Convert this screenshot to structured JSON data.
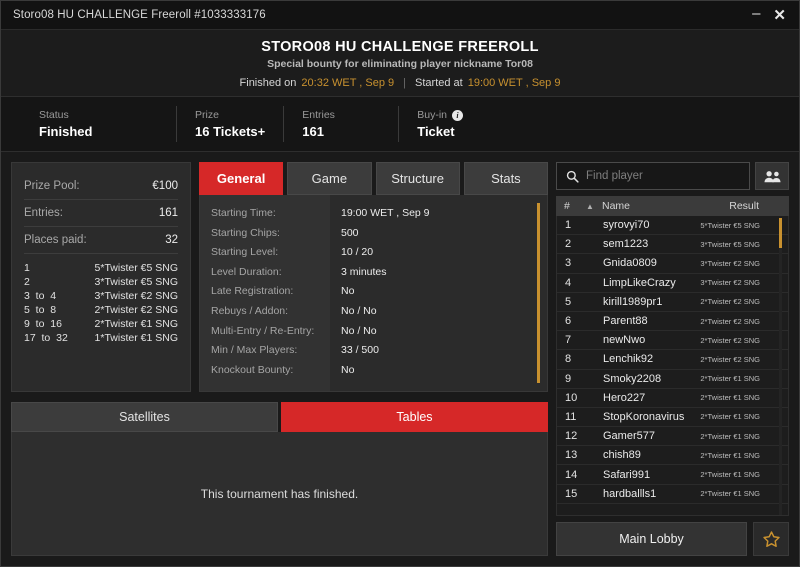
{
  "window": {
    "title": "Storo08 HU CHALLENGE Freeroll #1033333176",
    "minimize_label": "–",
    "close_label": "✕"
  },
  "header": {
    "title": "STORO08 HU CHALLENGE FREEROLL",
    "subtitle": "Special bounty for eliminating player nickname Tor08",
    "finished_prefix": "Finished on",
    "finished_time": "20:32 WET , Sep 9",
    "separator": "|",
    "started_prefix": "Started at",
    "started_time": "19:00 WET , Sep 9"
  },
  "status": {
    "cells": [
      {
        "label": "Status",
        "value": "Finished"
      },
      {
        "label": "Prize",
        "value": "16 Tickets+"
      },
      {
        "label": "Entries",
        "value": "161"
      },
      {
        "label": "Buy-in",
        "value": "Ticket",
        "info": "i"
      }
    ]
  },
  "prize_panel": {
    "rows": [
      {
        "key": "Prize Pool:",
        "value": "€100"
      },
      {
        "key": "Entries:",
        "value": "161"
      },
      {
        "key": "Places paid:",
        "value": "32"
      }
    ],
    "payouts": [
      {
        "place": "1",
        "prize": "5*Twister €5 SNG"
      },
      {
        "place": "2",
        "prize": "3*Twister €5 SNG"
      },
      {
        "place": "3  to  4",
        "prize": "3*Twister €2 SNG"
      },
      {
        "place": "5  to  8",
        "prize": "2*Twister €2 SNG"
      },
      {
        "place": "9  to  16",
        "prize": "2*Twister €1 SNG"
      },
      {
        "place": "17  to  32",
        "prize": "1*Twister €1 SNG"
      }
    ]
  },
  "tabs": [
    {
      "label": "General",
      "active": true
    },
    {
      "label": "Game",
      "active": false
    },
    {
      "label": "Structure",
      "active": false
    },
    {
      "label": "Stats",
      "active": false
    }
  ],
  "general_details": [
    {
      "label": "Starting Time:",
      "value": "19:00 WET , Sep 9"
    },
    {
      "label": "Starting Chips:",
      "value": "500"
    },
    {
      "label": "Starting Level:",
      "value": "10 / 20"
    },
    {
      "label": "Level Duration:",
      "value": "3 minutes"
    },
    {
      "label": "Late Registration:",
      "value": "No"
    },
    {
      "label": "Rebuys / Addon:",
      "value": "No / No"
    },
    {
      "label": "Multi-Entry / Re-Entry:",
      "value": "No / No"
    },
    {
      "label": "Min / Max Players:",
      "value": "33 / 500"
    },
    {
      "label": "Knockout Bounty:",
      "value": "No"
    }
  ],
  "section_tabs": [
    {
      "label": "Satellites",
      "active": false
    },
    {
      "label": "Tables",
      "active": true
    }
  ],
  "section_message": "This tournament has finished.",
  "search": {
    "placeholder": "Find player",
    "value": "",
    "icon": "search-icon",
    "people_icon": "people-icon"
  },
  "player_list": {
    "headers": {
      "num": "#",
      "sort_caret": "▲",
      "name": "Name",
      "result": "Result"
    },
    "rows": [
      {
        "num": "1",
        "name": "syrovyi70",
        "result": "5*Twister €5 SNG"
      },
      {
        "num": "2",
        "name": "sem1223",
        "result": "3*Twister €5 SNG"
      },
      {
        "num": "3",
        "name": "Gnida0809",
        "result": "3*Twister €2 SNG"
      },
      {
        "num": "4",
        "name": "LimpLikeCrazy",
        "result": "3*Twister €2 SNG"
      },
      {
        "num": "5",
        "name": "kirill1989pr1",
        "result": "2*Twister €2 SNG"
      },
      {
        "num": "6",
        "name": "Parent88",
        "result": "2*Twister €2 SNG"
      },
      {
        "num": "7",
        "name": "newNwo",
        "result": "2*Twister €2 SNG"
      },
      {
        "num": "8",
        "name": "Lenchik92",
        "result": "2*Twister €2 SNG"
      },
      {
        "num": "9",
        "name": "Smoky2208",
        "result": "2*Twister €1 SNG"
      },
      {
        "num": "10",
        "name": "Hero227",
        "result": "2*Twister €1 SNG"
      },
      {
        "num": "11",
        "name": "StopKoronavirus",
        "result": "2*Twister €1 SNG"
      },
      {
        "num": "12",
        "name": "Gamer577",
        "result": "2*Twister €1 SNG"
      },
      {
        "num": "13",
        "name": "chish89",
        "result": "2*Twister €1 SNG"
      },
      {
        "num": "14",
        "name": "Safari991",
        "result": "2*Twister €1 SNG"
      },
      {
        "num": "15",
        "name": "hardballls1",
        "result": "2*Twister €1 SNG"
      }
    ]
  },
  "footer": {
    "main_lobby": "Main Lobby",
    "star_icon": "star-icon"
  },
  "colors": {
    "accent_red": "#d62828",
    "amber": "#c8912f",
    "panel_bg": "#2b2b2b",
    "window_bg": "#1a1a1a"
  }
}
